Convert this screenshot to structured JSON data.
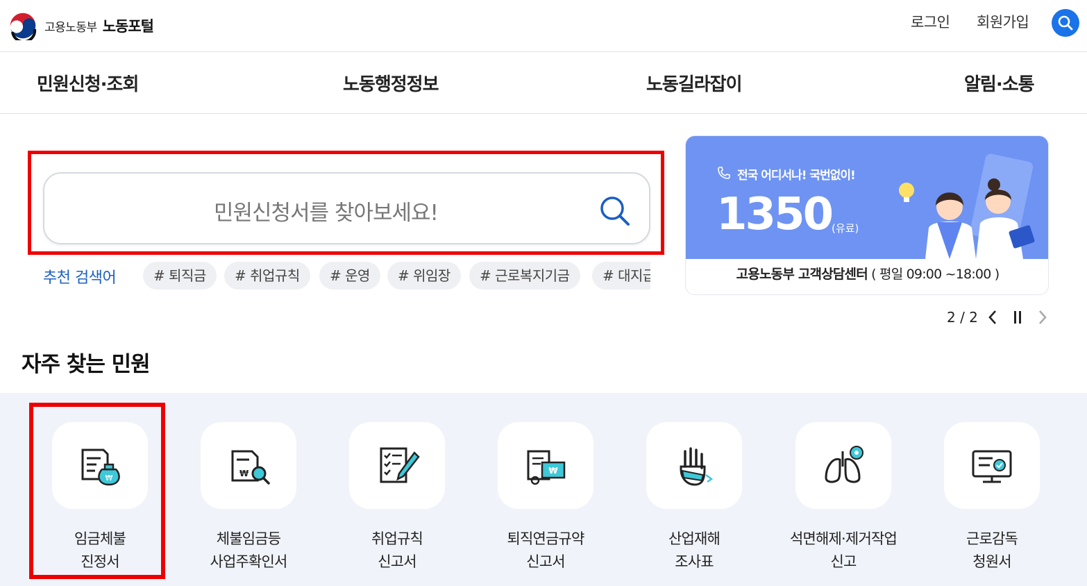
{
  "header": {
    "ministry": "고용노동부",
    "portal": "노동포털",
    "login": "로그인",
    "join": "회원가입"
  },
  "gnb": [
    "민원신청·조회",
    "노동행정정보",
    "노동길라잡이",
    "알림·소통"
  ],
  "search": {
    "placeholder": "민원신청서를 찾아보세요!",
    "recommend_label": "추천 검색어",
    "keywords": [
      "# 퇴직금",
      "# 취업규칙",
      "# 운영",
      "# 위임장",
      "# 근로복지기금",
      "# 대지급금"
    ]
  },
  "banner": {
    "subtitle": "전국 어디서나! 국번없이!",
    "number": "1350",
    "paid": "(유료)",
    "center": "고용노동부 고객상담센터",
    "hours": "( 평일 09:00 ~18:00 )",
    "pager": "2 / 2"
  },
  "frequent": {
    "title": "자주 찾는 민원",
    "items": [
      {
        "line1": "임금체불",
        "line2": "진정서",
        "icon": "wage-document-icon"
      },
      {
        "line1": "체불임금등",
        "line2": "사업주확인서",
        "icon": "document-search-icon"
      },
      {
        "line1": "취업규칙",
        "line2": "신고서",
        "icon": "checklist-pencil-icon"
      },
      {
        "line1": "퇴직연금규약",
        "line2": "신고서",
        "icon": "certificate-icon"
      },
      {
        "line1": "산업재해",
        "line2": "조사표",
        "icon": "injured-hand-icon"
      },
      {
        "line1": "석면해제·제거작업",
        "line2": "신고",
        "icon": "lungs-icon"
      },
      {
        "line1": "근로감독",
        "line2": "청원서",
        "icon": "monitor-check-icon"
      }
    ]
  },
  "colors": {
    "accent": "#1a73e8",
    "highlight": "#ee0000",
    "banner": "#6e93f2",
    "section_bg": "#f0f3f9"
  }
}
